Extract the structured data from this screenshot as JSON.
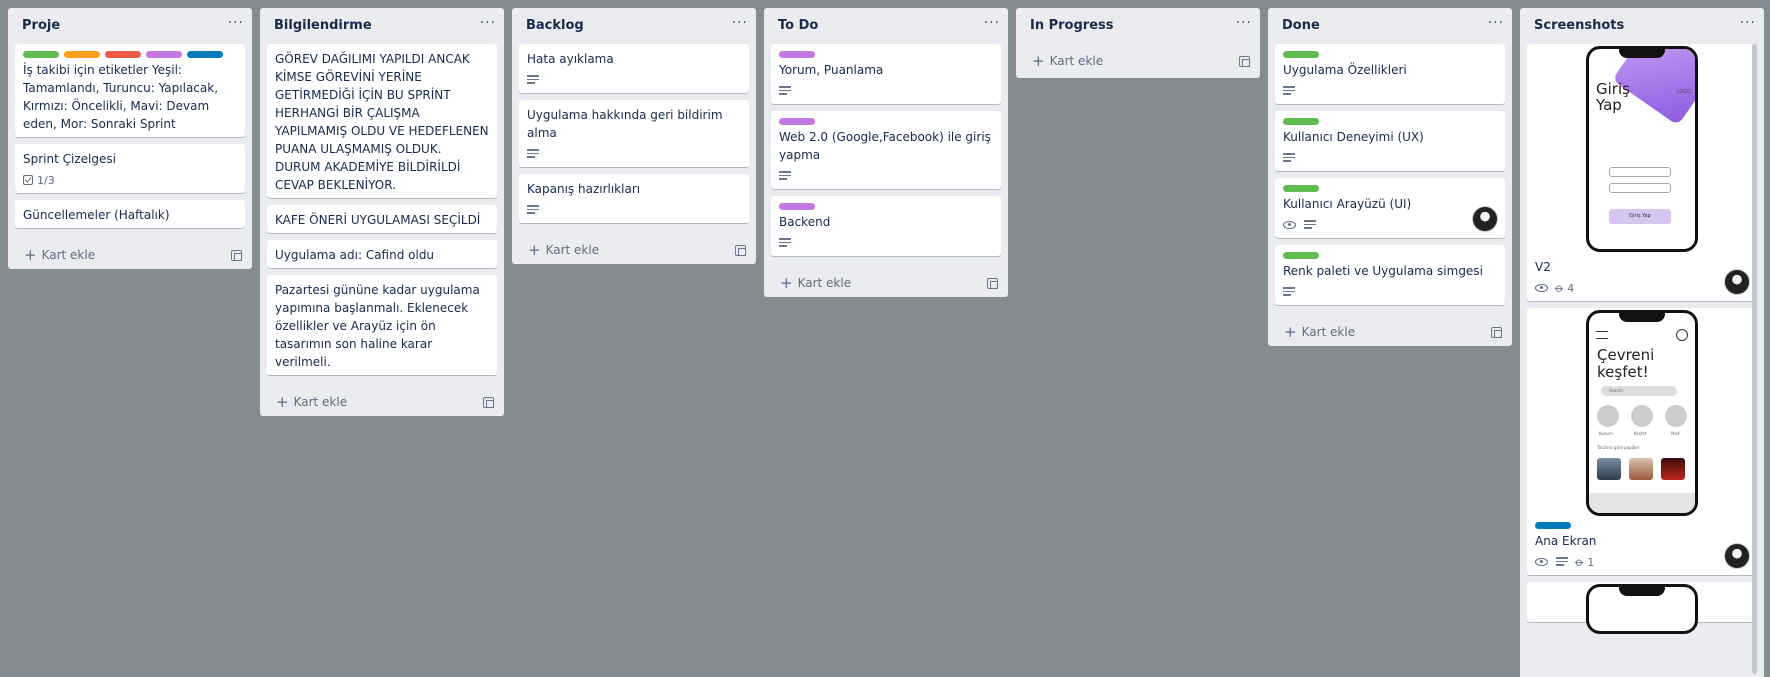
{
  "colors": {
    "board_bg": "#838c91",
    "green": "#61bd4f",
    "orange": "#ff9f1a",
    "red": "#eb5a46",
    "purple": "#c377e0",
    "blue": "#0079bf"
  },
  "common": {
    "add_card": "Kart ekle",
    "menu": "···"
  },
  "lists": {
    "proje": {
      "title": "Proje",
      "cards": [
        {
          "title": "İş takibi için etiketler Yeşil: Tamamlandı, Turuncu: Yapılacak, Kırmızı: Öncelikli, Mavi: Devam eden, Mor: Sonraki Sprint",
          "labels": [
            "green",
            "orange",
            "red",
            "purple",
            "blue"
          ]
        },
        {
          "title": "Sprint Çizelgesi",
          "checklist": "1/3"
        },
        {
          "title": "Güncellemeler (Haftalık)"
        }
      ]
    },
    "bilgi": {
      "title": "Bilgilendirme",
      "cards": [
        {
          "title": "GÖREV DAĞILIMI YAPILDI ANCAK KİMSE GÖREVİNİ YERİNE GETİRMEDİĞİ İÇİN BU SPRİNT HERHANGİ BİR ÇALIŞMA YAPILMAMIŞ OLDU VE HEDEFLENEN PUANA ULAŞMAMIŞ OLDUK. DURUM AKADEMİYE BİLDİRİLDİ CEVAP BEKLENİYOR."
        },
        {
          "title": "KAFE ÖNERİ UYGULAMASI SEÇİLDİ"
        },
        {
          "title": "Uygulama adı: Cafind oldu"
        },
        {
          "title": "Pazartesi gününe kadar uygulama yapımına başlanmalı. Eklenecek özellikler ve Arayüz için ön tasarımın son haline karar verilmeli."
        }
      ]
    },
    "backlog": {
      "title": "Backlog",
      "cards": [
        {
          "title": "Hata ayıklama"
        },
        {
          "title": "Uygulama hakkında geri bildirim alma"
        },
        {
          "title": "Kapanış hazırlıkları"
        }
      ]
    },
    "todo": {
      "title": "To Do",
      "cards": [
        {
          "title": "Yorum, Puanlama"
        },
        {
          "title": "Web 2.0 (Google,Facebook) ile giriş yapma"
        },
        {
          "title": "Backend"
        }
      ]
    },
    "inprogress": {
      "title": "In Progress"
    },
    "done": {
      "title": "Done",
      "cards": [
        {
          "title": "Uygulama Özellikleri"
        },
        {
          "title": "Kullanıcı Deneyimi (UX)"
        },
        {
          "title": "Kullanıcı Arayüzü (UI)"
        },
        {
          "title": "Renk paleti ve Uygulama simgesi"
        }
      ]
    },
    "screens": {
      "title": "Screenshots",
      "cards": [
        {
          "title": "V2",
          "attachments": "4",
          "phone_title": "Giriş Yap",
          "phone_logo": "LOGO",
          "phone_button": "Giriş Yap"
        },
        {
          "title": "Ana Ekran",
          "attachments": "1",
          "phone_title": "Çevreni keşfet!",
          "phone_search": "Search",
          "cats": [
            "Konum",
            "Keşfet",
            "Mod"
          ],
          "popular": "Tarzlara göre popüler"
        }
      ]
    }
  }
}
